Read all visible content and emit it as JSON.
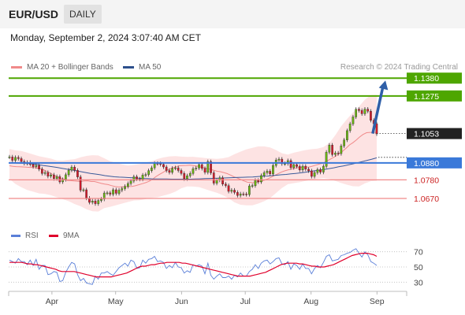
{
  "header": {
    "pair": "EUR/USD",
    "timeframe": "DAILY",
    "datetime": "Monday, September 2, 2024 3:07:40 AM CET"
  },
  "legend": {
    "ma20": "MA 20 + Bollinger Bands",
    "ma50": "MA 50",
    "rsi": "RSI",
    "ma9": "9MA"
  },
  "credit": "Research © 2024 Trading Central",
  "colors": {
    "resistance": "#4ea600",
    "current": "#222222",
    "pivot": "#3a79d9",
    "support": "#f08a8a",
    "arrow": "#2f5fa8",
    "bollinger_fill": "#fde0e0",
    "ma20": "#f08a8a",
    "ma50": "#3a5a9a",
    "rsi": "#5a7fd8",
    "ma9": "#e0002b",
    "candle_up": "#6ab80f",
    "candle_down": "#d41a2a"
  },
  "chart_data": [
    {
      "type": "candlestick",
      "title": "EUR/USD daily",
      "x_ticks": [
        "Apr",
        "May",
        "Jun",
        "Jul",
        "Aug",
        "Sep"
      ],
      "x_range": [
        "2024-03-12",
        "2024-09-15"
      ],
      "y_range": [
        1.0605,
        1.1395
      ],
      "price_levels": [
        {
          "label": "1.1380",
          "value": 1.138,
          "kind": "resistance"
        },
        {
          "label": "1.1275",
          "value": 1.1275,
          "kind": "resistance"
        },
        {
          "label": "1.1053",
          "value": 1.1053,
          "kind": "current"
        },
        {
          "label": "1.0880",
          "value": 1.088,
          "kind": "pivot"
        },
        {
          "label": "1.0780",
          "value": 1.078,
          "kind": "support"
        },
        {
          "label": "1.0670",
          "value": 1.067,
          "kind": "support"
        }
      ],
      "forecast_arrow": {
        "from": [
          "2024-08-30",
          1.1053
        ],
        "to": [
          "2024-09-05",
          1.138
        ]
      },
      "closes": [
        1.0915,
        1.0895,
        1.0912,
        1.0905,
        1.0888,
        1.0877,
        1.0883,
        1.0871,
        1.0858,
        1.0865,
        1.0843,
        1.0818,
        1.0823,
        1.0801,
        1.0809,
        1.0787,
        1.0799,
        1.0768,
        1.0782,
        1.081,
        1.0837,
        1.0855,
        1.0836,
        1.0797,
        1.0719,
        1.0721,
        1.0672,
        1.0647,
        1.0655,
        1.0639,
        1.0658,
        1.0666,
        1.0702,
        1.0703,
        1.0695,
        1.0721,
        1.07,
        1.0719,
        1.0728,
        1.0741,
        1.0758,
        1.0773,
        1.0798,
        1.0785,
        1.0784,
        1.0808,
        1.0811,
        1.0834,
        1.0851,
        1.0877,
        1.0876,
        1.0871,
        1.0856,
        1.0835,
        1.0824,
        1.0848,
        1.0851,
        1.0835,
        1.0818,
        1.0786,
        1.0804,
        1.0818,
        1.0845,
        1.085,
        1.087,
        1.0847,
        1.0824,
        1.0887,
        1.0821,
        1.076,
        1.0778,
        1.0792,
        1.0755,
        1.0746,
        1.0712,
        1.0719,
        1.0706,
        1.0688,
        1.0697,
        1.0696,
        1.0693,
        1.0744,
        1.0746,
        1.0777,
        1.0768,
        1.0805,
        1.0822,
        1.0831,
        1.0815,
        1.0865,
        1.0897,
        1.0902,
        1.0875,
        1.0876,
        1.0893,
        1.0852,
        1.087,
        1.0859,
        1.0838,
        1.086,
        1.0843,
        1.0833,
        1.08,
        1.0823,
        1.084,
        1.0825,
        1.086,
        1.0943,
        1.0985,
        1.0929,
        1.0938,
        1.0935,
        1.098,
        1.1015,
        1.107,
        1.111,
        1.1151,
        1.1196,
        1.1189,
        1.117,
        1.1197,
        1.1185,
        1.1131,
        1.1111,
        1.1051
      ],
      "ma20": [
        1.0863,
        1.0859,
        1.0858,
        1.0857,
        1.0856,
        1.0855,
        1.0853,
        1.0853,
        1.085,
        1.0845,
        1.084,
        1.0829,
        1.082,
        1.0808,
        1.0799,
        1.0789,
        1.0784,
        1.0776,
        1.0775,
        1.0773,
        1.0772,
        1.077,
        1.0773,
        1.0774,
        1.077,
        1.077,
        1.0765,
        1.0759,
        1.0755,
        1.0752,
        1.0746,
        1.074,
        1.0738,
        1.0738,
        1.074,
        1.074,
        1.0741,
        1.0745,
        1.0751,
        1.0757,
        1.0763,
        1.0771,
        1.0782,
        1.0798,
        1.0811,
        1.0822,
        1.0834,
        1.0843,
        1.0851,
        1.0857,
        1.0863,
        1.0864,
        1.0865,
        1.0866,
        1.0864,
        1.0861,
        1.0857,
        1.0852,
        1.0848,
        1.0842,
        1.0837,
        1.0831,
        1.0828,
        1.0823,
        1.0817,
        1.0808,
        1.0798,
        1.0791,
        1.0782,
        1.0773,
        1.0766,
        1.0765,
        1.0763,
        1.0767,
        1.0771,
        1.0778,
        1.0786,
        1.0796,
        1.0806,
        1.0816,
        1.0826,
        1.0833,
        1.0839,
        1.0844,
        1.0849,
        1.0852,
        1.0854,
        1.0856,
        1.0855,
        1.086,
        1.0866,
        1.0872,
        1.0878,
        1.0887,
        1.0898,
        1.0909,
        1.092,
        1.0935,
        1.095,
        1.0967,
        1.0986,
        1.0999,
        1.1015,
        1.1033,
        1.1048,
        1.1058,
        1.106,
        1.106,
        1.106
      ],
      "ma50": [
        1.088,
        1.0879,
        1.0878,
        1.0877,
        1.0876,
        1.0874,
        1.087,
        1.0865,
        1.0861,
        1.0857,
        1.0853,
        1.0848,
        1.0843,
        1.0839,
        1.0833,
        1.0828,
        1.0823,
        1.0818,
        1.0814,
        1.081,
        1.0805,
        1.0801,
        1.0798,
        1.0796,
        1.0795,
        1.0793,
        1.0792,
        1.079,
        1.0788,
        1.0787,
        1.0785,
        1.0785,
        1.0785,
        1.0785,
        1.0784,
        1.0784,
        1.0784,
        1.0784,
        1.0784,
        1.0785,
        1.0786,
        1.0787,
        1.0788,
        1.0789,
        1.079,
        1.0791,
        1.0792,
        1.0793,
        1.0794,
        1.0795,
        1.0796,
        1.0797,
        1.0799,
        1.0801,
        1.0802,
        1.0805,
        1.0807,
        1.081,
        1.0812,
        1.0815,
        1.0818,
        1.0821,
        1.0825,
        1.0829,
        1.0833,
        1.0837,
        1.0841,
        1.0846,
        1.0851,
        1.0857,
        1.0862,
        1.0868,
        1.0874,
        1.0881,
        1.0888,
        1.0895,
        1.0902,
        1.091
      ],
      "bollinger_upper": [
        1.0962,
        1.0954,
        1.095,
        1.0941,
        1.093,
        1.0919,
        1.0912,
        1.0905,
        1.0894,
        1.0893,
        1.0898,
        1.0902,
        1.0913,
        1.0921,
        1.0925,
        1.0924,
        1.0907,
        1.089,
        1.0881,
        1.0871,
        1.0865,
        1.0868,
        1.0873,
        1.0882,
        1.089,
        1.0903,
        1.0912,
        1.0918,
        1.092,
        1.0917,
        1.0915,
        1.0916,
        1.0912,
        1.0909,
        1.0906,
        1.0904,
        1.0907,
        1.0914,
        1.0931,
        1.0946,
        1.096,
        1.0969,
        1.0977,
        1.0977,
        1.0971,
        1.0956,
        1.0937,
        1.0929,
        1.094,
        1.0948,
        1.0956,
        1.0961,
        1.0964,
        1.0973,
        1.0997,
        1.1043,
        1.1096,
        1.1139,
        1.1178,
        1.1213,
        1.1253,
        1.128,
        1.1281
      ],
      "bollinger_lower": [
        1.0785,
        1.0756,
        1.0736,
        1.072,
        1.071,
        1.07,
        1.0697,
        1.0689,
        1.0677,
        1.0666,
        1.0654,
        1.0637,
        1.0624,
        1.0606,
        1.0595,
        1.0593,
        1.0613,
        1.0621,
        1.063,
        1.064,
        1.0649,
        1.0658,
        1.066,
        1.0666,
        1.0674,
        1.0677,
        1.0687,
        1.0696,
        1.071,
        1.073,
        1.0741,
        1.074,
        1.0737,
        1.0726,
        1.0714,
        1.0704,
        1.0689,
        1.0671,
        1.0647,
        1.0633,
        1.0629,
        1.0629,
        1.064,
        1.0654,
        1.0672,
        1.0702,
        1.0732,
        1.0754,
        1.076,
        1.0766,
        1.0773,
        1.0781,
        1.0786,
        1.079,
        1.0785,
        1.0773,
        1.0761,
        1.0751,
        1.0742,
        1.0741,
        1.0759,
        1.0772,
        1.0774
      ]
    },
    {
      "type": "line",
      "title": "RSI",
      "y_ticks": [
        "70",
        "50",
        "30"
      ],
      "y_range": [
        20,
        80
      ],
      "series": [
        {
          "name": "RSI",
          "values": [
            59,
            57,
            55,
            61,
            57,
            57,
            53,
            59,
            52,
            60,
            47,
            52,
            52,
            40,
            41,
            44,
            43,
            31,
            32,
            43,
            50,
            56,
            54,
            40,
            32,
            35,
            29,
            28,
            27,
            38,
            34,
            42,
            42,
            44,
            41,
            39,
            44,
            49,
            52,
            55,
            51,
            59,
            57,
            48,
            49,
            59,
            55,
            60,
            61,
            64,
            57,
            58,
            56,
            48,
            52,
            49,
            56,
            50,
            49,
            42,
            45,
            43,
            53,
            51,
            53,
            51,
            41,
            55,
            39,
            34,
            38,
            41,
            36,
            36,
            38,
            34,
            39,
            37,
            42,
            38,
            38,
            44,
            47,
            53,
            48,
            55,
            58,
            59,
            54,
            57,
            61,
            62,
            54,
            53,
            57,
            47,
            54,
            52,
            47,
            54,
            48,
            48,
            41,
            48,
            52,
            49,
            56,
            64,
            66,
            58,
            59,
            60,
            65,
            66,
            68,
            69,
            72,
            74,
            68,
            63,
            70,
            66,
            57,
            55,
            52
          ]
        },
        {
          "name": "9MA",
          "values": [
            56,
            56,
            56,
            56,
            56,
            55,
            54,
            54,
            53,
            53,
            52,
            51,
            50,
            49,
            48,
            47,
            45,
            44,
            44,
            44,
            44,
            44,
            43,
            42,
            41,
            40,
            39,
            38,
            37,
            37,
            37,
            37,
            37,
            37,
            38,
            39,
            40,
            41,
            42,
            44,
            46,
            48,
            50,
            51,
            51,
            52,
            53,
            53,
            54,
            55,
            55,
            56,
            56,
            56,
            56,
            56,
            55,
            55,
            54,
            53,
            52,
            51,
            50,
            49,
            48,
            47,
            46,
            45,
            44,
            43,
            42,
            41,
            40,
            39,
            38,
            38,
            38,
            38,
            38,
            39,
            40,
            41,
            42,
            43,
            45,
            47,
            49,
            51,
            53,
            54,
            55,
            55,
            55,
            55,
            54,
            54,
            53,
            52,
            51,
            51,
            50,
            50,
            50,
            51,
            52,
            53,
            55,
            57,
            59,
            61,
            63,
            65,
            66,
            67,
            68,
            68,
            68,
            67,
            66,
            64
          ]
        }
      ]
    }
  ]
}
